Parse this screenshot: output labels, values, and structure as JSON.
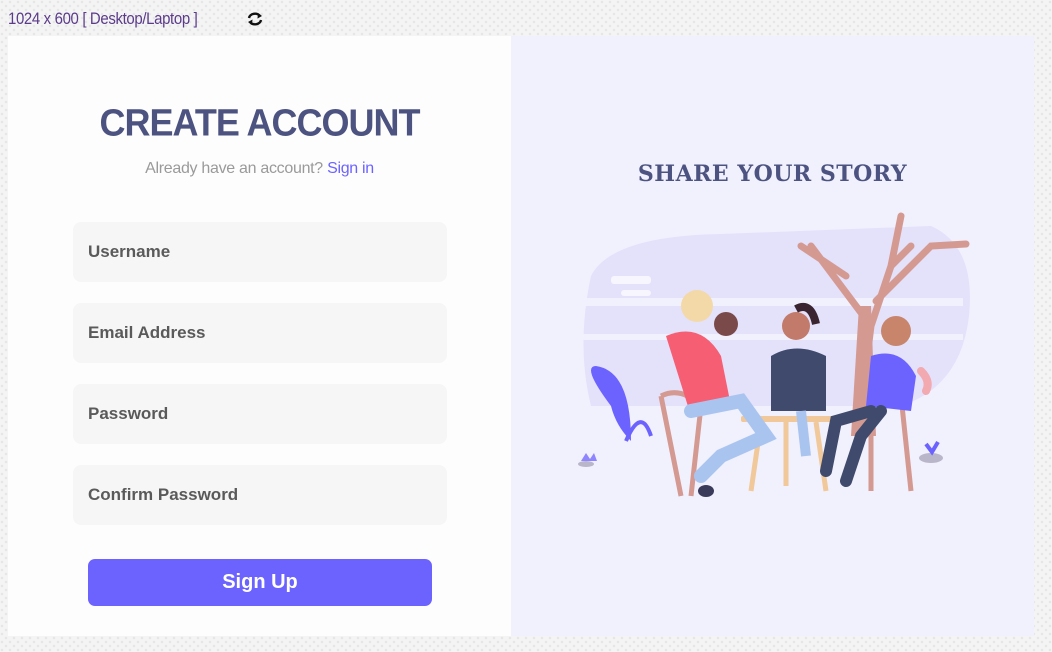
{
  "topbar": {
    "size_label": "1024 x 600 [ Desktop/Laptop ]",
    "rotate_icon": "rotate-icon"
  },
  "form": {
    "title": "CREATE ACCOUNT",
    "subtitle_text": "Already have an account?",
    "signin_link": "Sign in",
    "username_placeholder": "Username",
    "email_placeholder": "Email Address",
    "password_placeholder": "Password",
    "confirm_placeholder": "Confirm Password",
    "submit_label": "Sign Up"
  },
  "side": {
    "title": "SHARE YOUR STORY"
  },
  "colors": {
    "accent": "#6c63ff",
    "heading": "#4c5380",
    "panel": "#f1f0fd"
  }
}
